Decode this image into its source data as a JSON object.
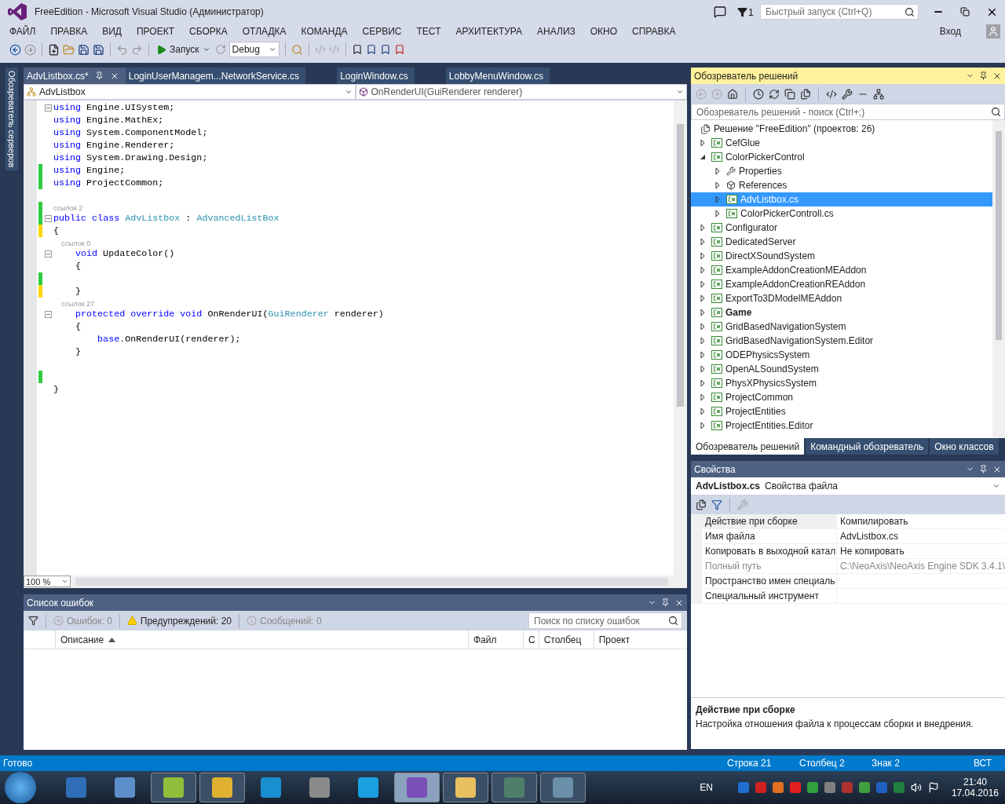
{
  "window": {
    "title": "FreeEdition - Microsoft Visual Studio (Администратор)",
    "notifications": "1",
    "quick_launch": {
      "placeholder": "Быстрый запуск (Ctrl+Q)"
    },
    "sign_in": "Вход"
  },
  "menu": [
    "ФАЙЛ",
    "ПРАВКА",
    "ВИД",
    "ПРОЕКТ",
    "СБОРКА",
    "ОТЛАДКА",
    "КОМАНДА",
    "СЕРВИС",
    "ТЕСТ",
    "АРХИТЕКТУРА",
    "АНАЛИЗ",
    "ОКНО",
    "СПРАВКА"
  ],
  "toolbar": {
    "run": "Запуск",
    "configuration": "Debug"
  },
  "server_explorer": "Обозреватель серверов",
  "editor": {
    "tabs": [
      {
        "label": "AdvListbox.cs*",
        "selected": true
      },
      {
        "label": "LoginUserManagem...NetworkService.cs",
        "selected": false
      },
      {
        "label": "LoginWindow.cs",
        "selected": false
      },
      {
        "label": "LobbyMenuWindow.cs",
        "selected": false
      }
    ],
    "type_dropdown": "AdvListbox",
    "member_dropdown": "OnRenderUI(GuiRenderer renderer)",
    "zoom": "100 %",
    "lines": [
      {
        "kind": "code",
        "fold": true,
        "saved": false,
        "unsaved": false,
        "tokens": [
          {
            "t": "using",
            "kind": "keyword"
          },
          {
            "t": " Engine.UISystem;",
            "kind": "plain"
          }
        ]
      },
      {
        "kind": "code",
        "fold": false,
        "saved": false,
        "unsaved": false,
        "tokens": [
          {
            "t": "using",
            "kind": "keyword"
          },
          {
            "t": " Engine.MathEx;",
            "kind": "plain"
          }
        ]
      },
      {
        "kind": "code",
        "fold": false,
        "saved": false,
        "unsaved": false,
        "tokens": [
          {
            "t": "using",
            "kind": "keyword"
          },
          {
            "t": " System.ComponentModel;",
            "kind": "plain"
          }
        ]
      },
      {
        "kind": "code",
        "fold": false,
        "saved": false,
        "unsaved": false,
        "tokens": [
          {
            "t": "using",
            "kind": "keyword"
          },
          {
            "t": " Engine.Renderer;",
            "kind": "plain"
          }
        ]
      },
      {
        "kind": "code",
        "fold": false,
        "saved": false,
        "unsaved": false,
        "tokens": [
          {
            "t": "using",
            "kind": "keyword"
          },
          {
            "t": " System.Drawing.Design;",
            "kind": "plain"
          }
        ]
      },
      {
        "kind": "code",
        "fold": false,
        "saved": true,
        "unsaved": false,
        "tokens": [
          {
            "t": "using",
            "kind": "keyword"
          },
          {
            "t": " Engine;",
            "kind": "plain"
          }
        ]
      },
      {
        "kind": "code",
        "fold": false,
        "saved": true,
        "unsaved": false,
        "tokens": [
          {
            "t": "using",
            "kind": "keyword"
          },
          {
            "t": " ProjectCommon;",
            "kind": "plain"
          }
        ]
      },
      {
        "kind": "code",
        "fold": false,
        "saved": false,
        "unsaved": false
      },
      {
        "kind": "lens",
        "fold": false,
        "saved": true,
        "unsaved": false,
        "tokens": [
          {
            "t": "ссылок 2",
            "kind": "plain"
          }
        ]
      },
      {
        "kind": "code",
        "fold": true,
        "saved": true,
        "unsaved": false,
        "tokens": [
          {
            "t": "public",
            "kind": "keyword"
          },
          {
            "t": " class",
            "kind": "keyword"
          },
          {
            "t": " AdvListbox",
            "kind": "type"
          },
          {
            "t": " :",
            "kind": "plain"
          },
          {
            "t": " AdvancedListBox",
            "kind": "type"
          }
        ]
      },
      {
        "kind": "code",
        "fold": false,
        "saved": false,
        "unsaved": true,
        "tokens": [
          {
            "t": "{",
            "kind": "plain"
          }
        ]
      },
      {
        "kind": "lens",
        "fold": false,
        "saved": false,
        "unsaved": false,
        "tokens": [
          {
            "t": "    ссылок 0",
            "kind": "plain"
          }
        ]
      },
      {
        "kind": "code",
        "fold": true,
        "saved": false,
        "unsaved": false,
        "tokens": [
          {
            "t": "    void",
            "kind": "keyword"
          },
          {
            "t": " UpdateColor()",
            "kind": "plain"
          }
        ]
      },
      {
        "kind": "code",
        "fold": false,
        "saved": false,
        "unsaved": false,
        "tokens": [
          {
            "t": "    {",
            "kind": "plain"
          }
        ]
      },
      {
        "kind": "code",
        "fold": false,
        "saved": true,
        "unsaved": false
      },
      {
        "kind": "code",
        "fold": false,
        "saved": false,
        "unsaved": true,
        "tokens": [
          {
            "t": "    }",
            "kind": "plain"
          }
        ]
      },
      {
        "kind": "lens",
        "fold": false,
        "saved": false,
        "unsaved": false,
        "tokens": [
          {
            "t": "    ссылок 27",
            "kind": "plain"
          }
        ]
      },
      {
        "kind": "code",
        "fold": true,
        "saved": false,
        "unsaved": false,
        "tokens": [
          {
            "t": "    protected",
            "kind": "keyword"
          },
          {
            "t": " override",
            "kind": "keyword"
          },
          {
            "t": " void",
            "kind": "keyword"
          },
          {
            "t": " OnRenderUI(",
            "kind": "plain"
          },
          {
            "t": "GuiRenderer",
            "kind": "type"
          },
          {
            "t": " renderer)",
            "kind": "plain"
          }
        ]
      },
      {
        "kind": "code",
        "fold": false,
        "saved": false,
        "unsaved": false,
        "tokens": [
          {
            "t": "    {",
            "kind": "plain"
          }
        ]
      },
      {
        "kind": "code",
        "fold": false,
        "saved": false,
        "unsaved": false,
        "tokens": [
          {
            "t": "        base",
            "kind": "keyword"
          },
          {
            "t": ".OnRenderUI(renderer);",
            "kind": "plain"
          }
        ]
      },
      {
        "kind": "code",
        "fold": false,
        "saved": false,
        "unsaved": false,
        "tokens": [
          {
            "t": "    }",
            "kind": "plain"
          }
        ]
      },
      {
        "kind": "code",
        "fold": false,
        "saved": false,
        "unsaved": false
      },
      {
        "kind": "code",
        "fold": false,
        "saved": true,
        "unsaved": false
      },
      {
        "kind": "code",
        "fold": false,
        "saved": false,
        "unsaved": false,
        "tokens": [
          {
            "t": "}",
            "kind": "plain"
          }
        ]
      }
    ]
  },
  "error_list": {
    "title": "Список ошибок",
    "errors": "Ошибок: 0",
    "warnings": "Предупреждений: 20",
    "messages": "Сообщений: 0",
    "search": {
      "placeholder": "Поиск по списку ошибок"
    },
    "columns": [
      {
        "label": "Описание",
        "sorted": true
      },
      {
        "label": "Файл",
        "sorted": false
      },
      {
        "label": "С",
        "sorted": false
      },
      {
        "label": "Столбец",
        "sorted": false
      },
      {
        "label": "Проект",
        "sorted": false
      }
    ]
  },
  "solution_explorer": {
    "title": "Обозреватель решений",
    "search": {
      "placeholder": "Обозреватель решений - поиск (Ctrl+;)"
    },
    "tree": {
      "label": "Решение \"FreeEdition\"  (проектов: 26)",
      "kind": "solution",
      "selected": false,
      "startup": false,
      "children": [
        {
          "label": "CefGlue",
          "kind": "project",
          "expanded": false,
          "selected": false,
          "startup": false
        },
        {
          "label": "ColorPickerControl",
          "kind": "project",
          "expanded": true,
          "selected": false,
          "startup": false,
          "children": [
            {
              "label": "Properties",
              "kind": "properties",
              "expanded": false,
              "selected": false,
              "startup": false
            },
            {
              "label": "References",
              "kind": "references",
              "expanded": false,
              "selected": false,
              "startup": false
            },
            {
              "label": "AdvListbox.cs",
              "kind": "file",
              "expanded": false,
              "selected": true,
              "startup": false
            },
            {
              "label": "ColorPickerControll.cs",
              "kind": "file",
              "expanded": false,
              "selected": false,
              "startup": false
            }
          ]
        },
        {
          "label": "Configurator",
          "kind": "project",
          "expanded": false,
          "selected": false,
          "startup": false
        },
        {
          "label": "DedicatedServer",
          "kind": "project",
          "expanded": false,
          "selected": false,
          "startup": false
        },
        {
          "label": "DirectXSoundSystem",
          "kind": "project",
          "expanded": false,
          "selected": false,
          "startup": false
        },
        {
          "label": "ExampleAddonCreationMEAddon",
          "kind": "project",
          "expanded": false,
          "selected": false,
          "startup": false
        },
        {
          "label": "ExampleAddonCreationREAddon",
          "kind": "project",
          "expanded": false,
          "selected": false,
          "startup": false
        },
        {
          "label": "ExportTo3DModelMEAddon",
          "kind": "project",
          "expanded": false,
          "selected": false,
          "startup": false
        },
        {
          "label": "Game",
          "kind": "project",
          "expanded": false,
          "selected": false,
          "startup": true
        },
        {
          "label": "GridBasedNavigationSystem",
          "kind": "project",
          "expanded": false,
          "selected": false,
          "startup": false
        },
        {
          "label": "GridBasedNavigationSystem.Editor",
          "kind": "project",
          "expanded": false,
          "selected": false,
          "startup": false
        },
        {
          "label": "ODEPhysicsSystem",
          "kind": "project",
          "expanded": false,
          "selected": false,
          "startup": false
        },
        {
          "label": "OpenALSoundSystem",
          "kind": "project",
          "expanded": false,
          "selected": false,
          "startup": false
        },
        {
          "label": "PhysXPhysicsSystem",
          "kind": "project",
          "expanded": false,
          "selected": false,
          "startup": false
        },
        {
          "label": "ProjectCommon",
          "kind": "project",
          "expanded": false,
          "selected": false,
          "startup": false
        },
        {
          "label": "ProjectEntities",
          "kind": "project",
          "expanded": false,
          "selected": false,
          "startup": false
        },
        {
          "label": "ProjectEntities.Editor",
          "kind": "project",
          "expanded": false,
          "selected": false,
          "startup": false
        }
      ]
    },
    "tabs": [
      {
        "label": "Обозреватель решений",
        "selected": true
      },
      {
        "label": "Командный обозреватель",
        "selected": false
      },
      {
        "label": "Окно классов",
        "selected": false
      }
    ]
  },
  "properties": {
    "title": "Свойства",
    "object": "AdvListbox.cs",
    "object_type": "Свойства файла",
    "rows": [
      {
        "name": "Действие при сборке",
        "value": "Компилировать",
        "disabled": false,
        "selected": true
      },
      {
        "name": "Имя файла",
        "value": "AdvListbox.cs",
        "disabled": false,
        "selected": false
      },
      {
        "name": "Копировать в выходной катал",
        "value": "Не копировать",
        "disabled": false,
        "selected": false
      },
      {
        "name": "Полный путь",
        "value": "C:\\NeoAxis\\NeoAxis Engine SDK 3.4.1\\",
        "disabled": true,
        "selected": false
      },
      {
        "name": "Пространство имен специаль",
        "disabled": false,
        "selected": false
      },
      {
        "name": "Специальный инструмент",
        "disabled": false,
        "selected": false
      }
    ],
    "description_title": "Действие при сборке",
    "description": "Настройка отношения файла к процессам сборки и внедрения."
  },
  "status_bar": {
    "message": "Готово",
    "line": "Строка 21",
    "column": "Столбец 2",
    "char": "Знак 2",
    "mode": "ВСТ"
  },
  "taskbar": {
    "apps": [
      {
        "running": false,
        "selected": false
      },
      {
        "running": false,
        "selected": false
      },
      {
        "running": true,
        "selected": false
      },
      {
        "running": true,
        "selected": false
      },
      {
        "running": false,
        "selected": false
      },
      {
        "running": false,
        "selected": false
      },
      {
        "running": false,
        "selected": false
      },
      {
        "running": true,
        "selected": true
      },
      {
        "running": true,
        "selected": false
      },
      {
        "running": true,
        "selected": false
      },
      {
        "running": true,
        "selected": false
      }
    ],
    "language": "EN",
    "time": "21:40",
    "date": "17.04.2016"
  }
}
